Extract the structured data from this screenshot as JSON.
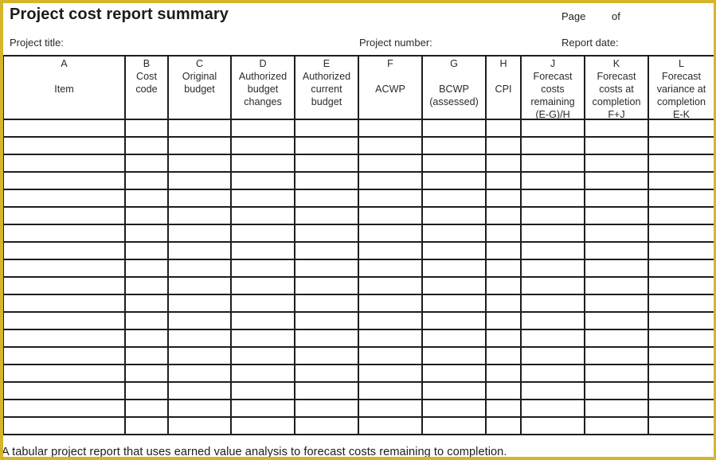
{
  "document": {
    "title": "Project cost report summary",
    "page_label": "Page",
    "of_label": "of",
    "fields": {
      "project_title_label": "Project title:",
      "project_number_label": "Project number:",
      "report_date_label": "Report date:"
    },
    "colors": {
      "frame": "#d4b52c",
      "ink": "#1e1e1e",
      "background": "#ffffff"
    },
    "table": {
      "columns": [
        {
          "letter": "A",
          "label": "Item",
          "lines": [
            "",
            "Item"
          ]
        },
        {
          "letter": "B",
          "label": "Cost code",
          "lines": [
            "Cost",
            "code"
          ]
        },
        {
          "letter": "C",
          "label": "Original budget",
          "lines": [
            "Original",
            "budget"
          ]
        },
        {
          "letter": "D",
          "label": "Authorized budget changes",
          "lines": [
            "Authorized",
            "budget",
            "changes"
          ]
        },
        {
          "letter": "E",
          "label": "Authorized current budget",
          "lines": [
            "Authorized",
            "current",
            "budget"
          ]
        },
        {
          "letter": "F",
          "label": "ACWP",
          "lines": [
            "",
            "ACWP"
          ]
        },
        {
          "letter": "G",
          "label": "BCWP (assessed)",
          "lines": [
            "",
            "BCWP",
            "(assessed)"
          ]
        },
        {
          "letter": "H",
          "label": "CPI",
          "lines": [
            "",
            "CPI"
          ]
        },
        {
          "letter": "J",
          "label": "Forecast costs remaining (E-G)/H",
          "lines": [
            "Forecast",
            "costs",
            "remaining",
            "(E-G)/H"
          ]
        },
        {
          "letter": "K",
          "label": "Forecast costs at completion F+J",
          "lines": [
            "Forecast",
            "costs at",
            "completion",
            "F+J"
          ]
        },
        {
          "letter": "L",
          "label": "Forecast variance at completion E-K",
          "lines": [
            "Forecast",
            "variance at",
            "completion",
            "E-K"
          ]
        }
      ],
      "row_count": 18,
      "rows": []
    },
    "caption": "A tabular project report that uses earned value analysis to forecast costs remaining to completion."
  }
}
